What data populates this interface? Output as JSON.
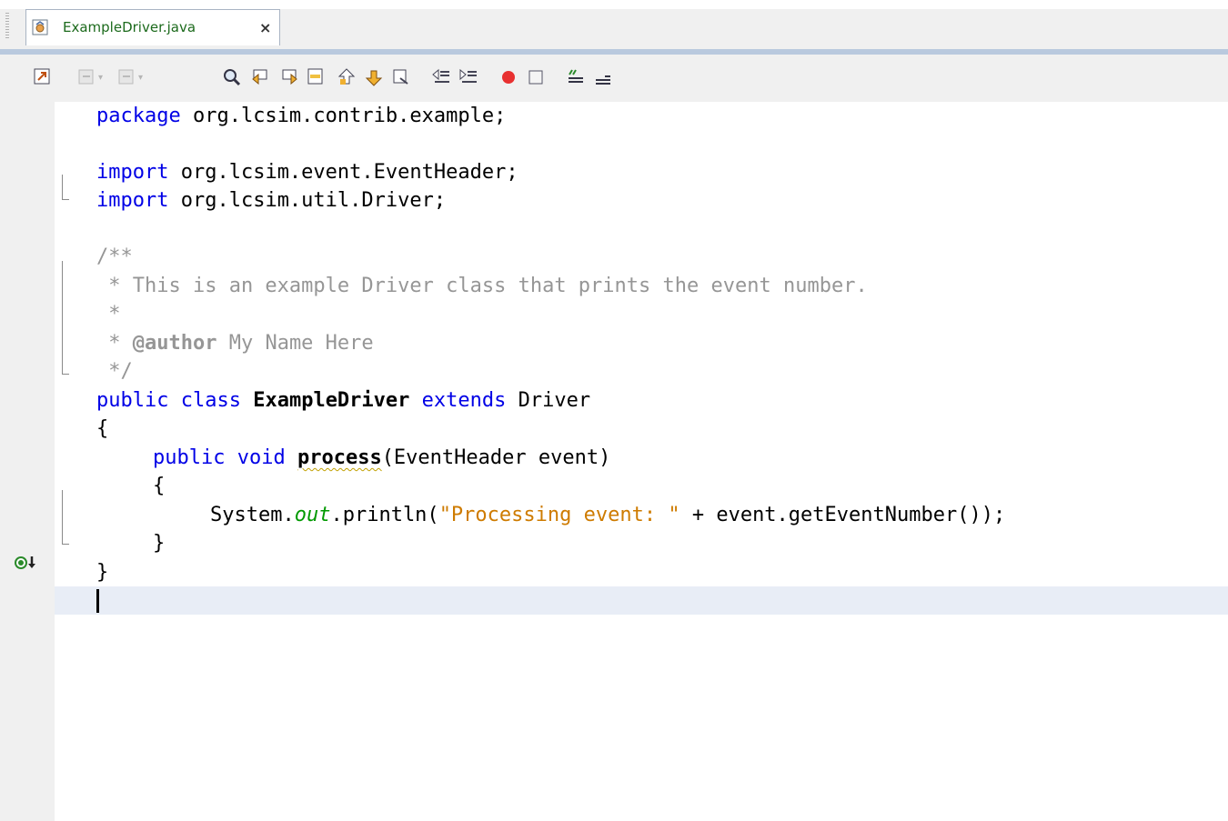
{
  "tab": {
    "filename": "ExampleDriver.java",
    "close": "×"
  },
  "toolbar": {
    "buttons": [
      "last-edit-icon",
      "back-icon",
      "forward-icon",
      "find-selection-icon",
      "find-previous-icon",
      "find-next-icon",
      "toggle-highlight-icon",
      "previous-bookmark-icon",
      "next-bookmark-icon",
      "toggle-bookmark-icon",
      "shift-left-icon",
      "shift-right-icon",
      "start-macro-icon",
      "stop-macro-icon",
      "comment-icon",
      "uncomment-icon"
    ]
  },
  "code": {
    "l1_kw": "package",
    "l1_rest": " org.lcsim.contrib.example;",
    "l3_kw": "import",
    "l3_rest": " org.lcsim.event.EventHeader;",
    "l4_kw": "import",
    "l4_rest": " org.lcsim.util.Driver;",
    "l6": "/**",
    "l7": " * This is an example Driver class that prints the event number.",
    "l8": " *",
    "l9_pre": " * ",
    "l9_tag": "@author",
    "l9_rest": " My Name Here",
    "l10": " */",
    "l11_kw1": "public",
    "l11_kw2": "class",
    "l11_name": "ExampleDriver",
    "l11_kw3": "extends",
    "l11_rest": " Driver",
    "l12": "{",
    "l13_kw1": "public",
    "l13_kw2": "void",
    "l13_method": "process",
    "l13_rest": "(EventHeader event)",
    "l14": "{",
    "l15_a": "System.",
    "l15_field": "out",
    "l15_b": ".println(",
    "l15_str": "\"Processing event: \"",
    "l15_c": " + event.getEventNumber());",
    "l16": "}",
    "l17": "}"
  },
  "colors": {
    "keyword": "#0000e6",
    "comment": "#969696",
    "string": "#ce7b00",
    "field": "#009900",
    "current_line": "#e8edf6"
  }
}
